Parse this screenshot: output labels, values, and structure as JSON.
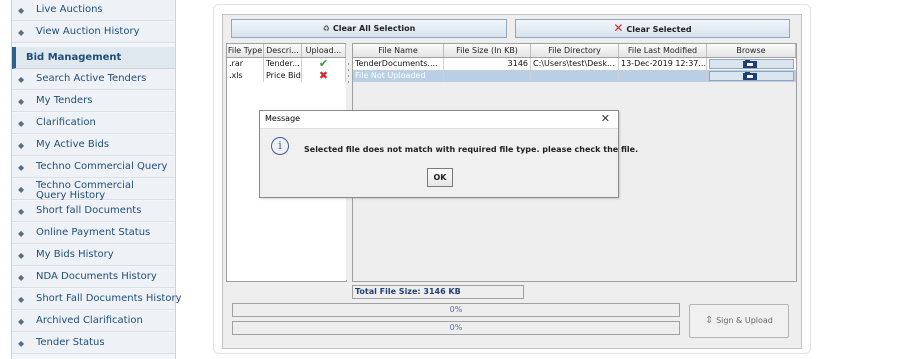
{
  "sidebar": {
    "items_top": [
      "Live Auctions",
      "View Auction History"
    ],
    "section_title": "Bid Management",
    "items": [
      "Search Active Tenders",
      "My Tenders",
      "Clarification",
      "My Active Bids",
      "Techno Commercial Query",
      "Techno Commercial Query History",
      "Short fall Documents",
      "Online Payment Status",
      "My Bids History",
      "NDA Documents History",
      "Short Fall Documents History",
      "Archived Clarification",
      "Tender Status"
    ]
  },
  "toolbar": {
    "clear_all_label": "Clear All Selection",
    "clear_selected_label": "Clear Selected"
  },
  "left_table": {
    "headers": [
      "File Type",
      "Descri...",
      "Upload..."
    ],
    "rows": [
      {
        "type": ".rar",
        "desc": "Tender...",
        "status": "uploaded"
      },
      {
        "type": ".xls",
        "desc": "Price Bid",
        "status": "not_uploaded"
      }
    ]
  },
  "right_table": {
    "headers": [
      "File Name",
      "File Size (In KB)",
      "File Directory",
      "File Last Modified",
      "Browse"
    ],
    "rows": [
      {
        "name": "TenderDocuments....",
        "size": "3146",
        "dir": "C:\\Users\\test\\Desk...",
        "modified": "13-Dec-2019 12:37..."
      },
      {
        "name": "File Not Uploaded",
        "size": "",
        "dir": "",
        "modified": ""
      }
    ]
  },
  "total_size": "Total File Size: 3146 KB",
  "progress": [
    {
      "label": "0%",
      "value": 0
    },
    {
      "label": "0%",
      "value": 0
    }
  ],
  "sign_upload_label": "Sign & Upload",
  "dialog": {
    "title": "Message",
    "message": "Selected file does not match with required file type. please check the file.",
    "ok_label": "OK"
  },
  "colors": {
    "sidebar_text": "#1f4e79",
    "check_green": "#2e9b2e",
    "cross_red": "#d8262b",
    "row_selected": "#b8cfe5"
  }
}
